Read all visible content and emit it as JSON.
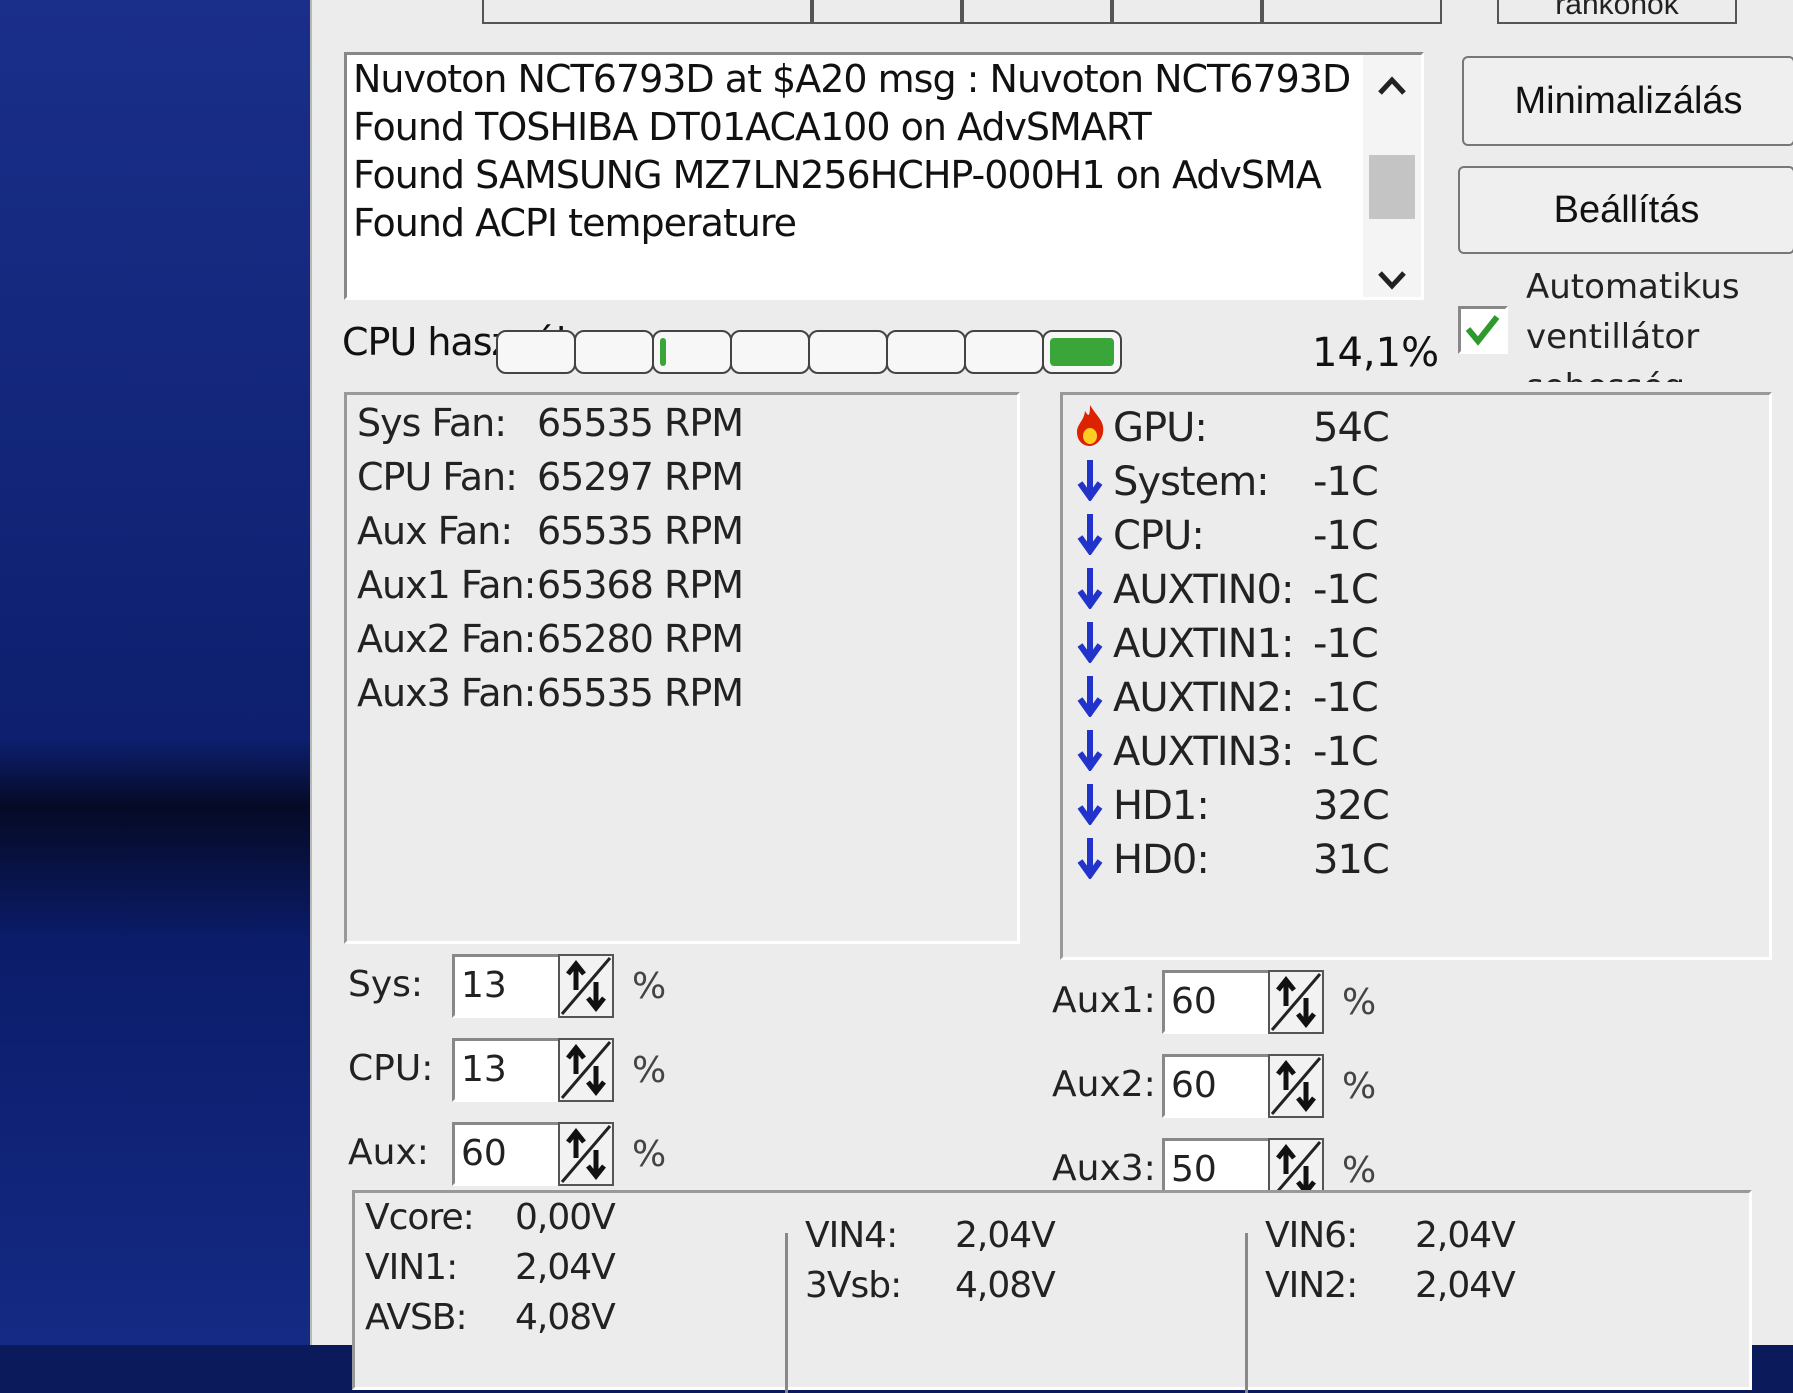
{
  "tabs": [
    "",
    "",
    "",
    "",
    "",
    "ránkönök"
  ],
  "log": {
    "lines": [
      "Nuvoton NCT6793D  at $A20 msg : Nuvoton NCT6793D",
      "Found TOSHIBA DT01ACA100 on AdvSMART",
      "Found SAMSUNG MZ7LN256HCHP-000H1 on AdvSMA",
      "Found ACPI temperature"
    ]
  },
  "buttons": {
    "minimize": "Minimalizálás",
    "settings": "Beállítás"
  },
  "auto_fan": {
    "line1": "Automatikus",
    "line2": "ventillátor",
    "line3": "sebesség",
    "checked": true
  },
  "cpu_usage": {
    "label": "CPU használ",
    "value": "14,1%",
    "fraction": 0.141,
    "cores_active": [
      0,
      0,
      0.1,
      0,
      0,
      0,
      0,
      1
    ]
  },
  "fans": [
    {
      "name": "Sys Fan:",
      "value": "65535 RPM"
    },
    {
      "name": "CPU Fan:",
      "value": "65297 RPM"
    },
    {
      "name": "Aux Fan:",
      "value": "65535 RPM"
    },
    {
      "name": "Aux1 Fan:",
      "value": "65368 RPM"
    },
    {
      "name": "Aux2 Fan:",
      "value": "65280 RPM"
    },
    {
      "name": "Aux3 Fan:",
      "value": "65535 RPM"
    }
  ],
  "temps": [
    {
      "name": "GPU:",
      "value": "54C",
      "icon": "flame-icon"
    },
    {
      "name": "System:",
      "value": "-1C",
      "icon": "arrow-down-icon"
    },
    {
      "name": "CPU:",
      "value": "-1C",
      "icon": "arrow-down-icon"
    },
    {
      "name": "AUXTIN0:",
      "value": "-1C",
      "icon": "arrow-down-icon"
    },
    {
      "name": "AUXTIN1:",
      "value": "-1C",
      "icon": "arrow-down-icon"
    },
    {
      "name": "AUXTIN2:",
      "value": "-1C",
      "icon": "arrow-down-icon"
    },
    {
      "name": "AUXTIN3:",
      "value": "-1C",
      "icon": "arrow-down-icon"
    },
    {
      "name": "HD1:",
      "value": "32C",
      "icon": "arrow-down-icon"
    },
    {
      "name": "HD0:",
      "value": "31C",
      "icon": "arrow-down-icon"
    }
  ],
  "speeds_left": [
    {
      "label": "Sys:",
      "value": "13",
      "unit": "%"
    },
    {
      "label": "CPU:",
      "value": "13",
      "unit": "%"
    },
    {
      "label": "Aux:",
      "value": "60",
      "unit": "%"
    }
  ],
  "speeds_right": [
    {
      "label": "Aux1:",
      "value": "60",
      "unit": "%"
    },
    {
      "label": "Aux2:",
      "value": "60",
      "unit": "%"
    },
    {
      "label": "Aux3:",
      "value": "50",
      "unit": "%"
    }
  ],
  "voltages": {
    "col1": [
      {
        "name": "Vcore:",
        "value": "0,00V"
      },
      {
        "name": "VIN1:",
        "value": "2,04V"
      },
      {
        "name": "AVSB:",
        "value": "4,08V"
      }
    ],
    "col2": [
      {
        "name": "VIN4:",
        "value": "2,04V"
      },
      {
        "name": "3Vsb:",
        "value": "4,08V"
      }
    ],
    "col3": [
      {
        "name": "VIN6:",
        "value": "2,04V"
      },
      {
        "name": "VIN2:",
        "value": "2,04V"
      }
    ]
  },
  "colors": {
    "accent_green": "#3aa63a",
    "arrow_blue": "#2233cc",
    "flame_red": "#dd2200"
  }
}
